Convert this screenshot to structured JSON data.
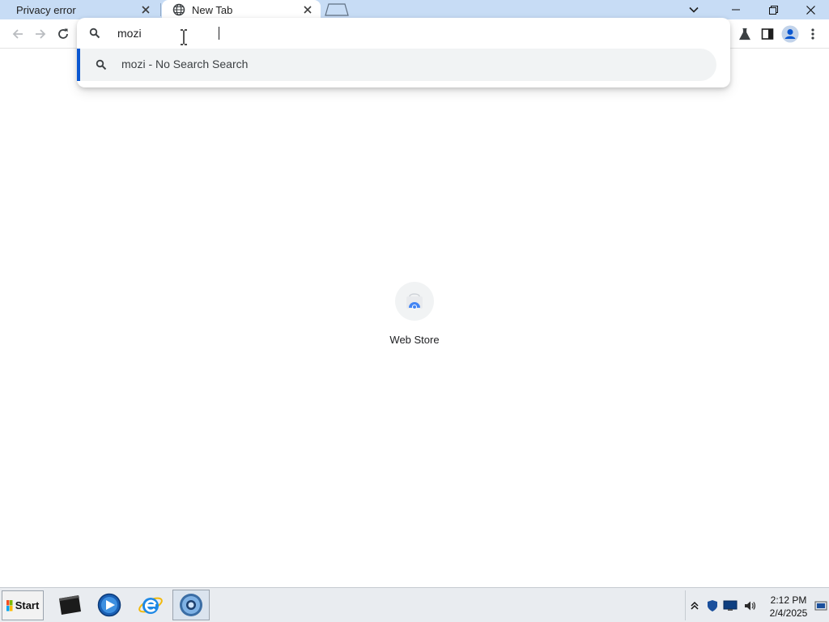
{
  "tabs": [
    {
      "title": "Privacy error",
      "active": false
    },
    {
      "title": "New Tab",
      "active": true
    }
  ],
  "omnibox": {
    "value": "mozi",
    "placeholder": "",
    "suggestions": [
      {
        "text": "mozi - No Search Search",
        "icon": "search-icon",
        "selected": true
      }
    ]
  },
  "new_tab_page": {
    "shortcuts": [
      {
        "label": "Web Store",
        "icon": "web-store-icon"
      }
    ]
  },
  "toolbar": {
    "icons": [
      "back-icon",
      "forward-icon",
      "reload-icon",
      "labs-flask-icon",
      "side-panel-icon",
      "profile-icon",
      "menu-kebab-icon"
    ]
  },
  "taskbar": {
    "start_label": "Start",
    "apps": [
      "terminal-icon",
      "media-player-icon",
      "internet-explorer-icon",
      "chrome-browser-icon"
    ],
    "clock_time": "2:12 PM",
    "clock_date": "2/4/2025"
  },
  "colors": {
    "tabstrip": "#c7dcf5",
    "accent": "#0b57d0",
    "suggestion_bg": "#f1f3f4",
    "taskbar": "#e9ecf0"
  }
}
